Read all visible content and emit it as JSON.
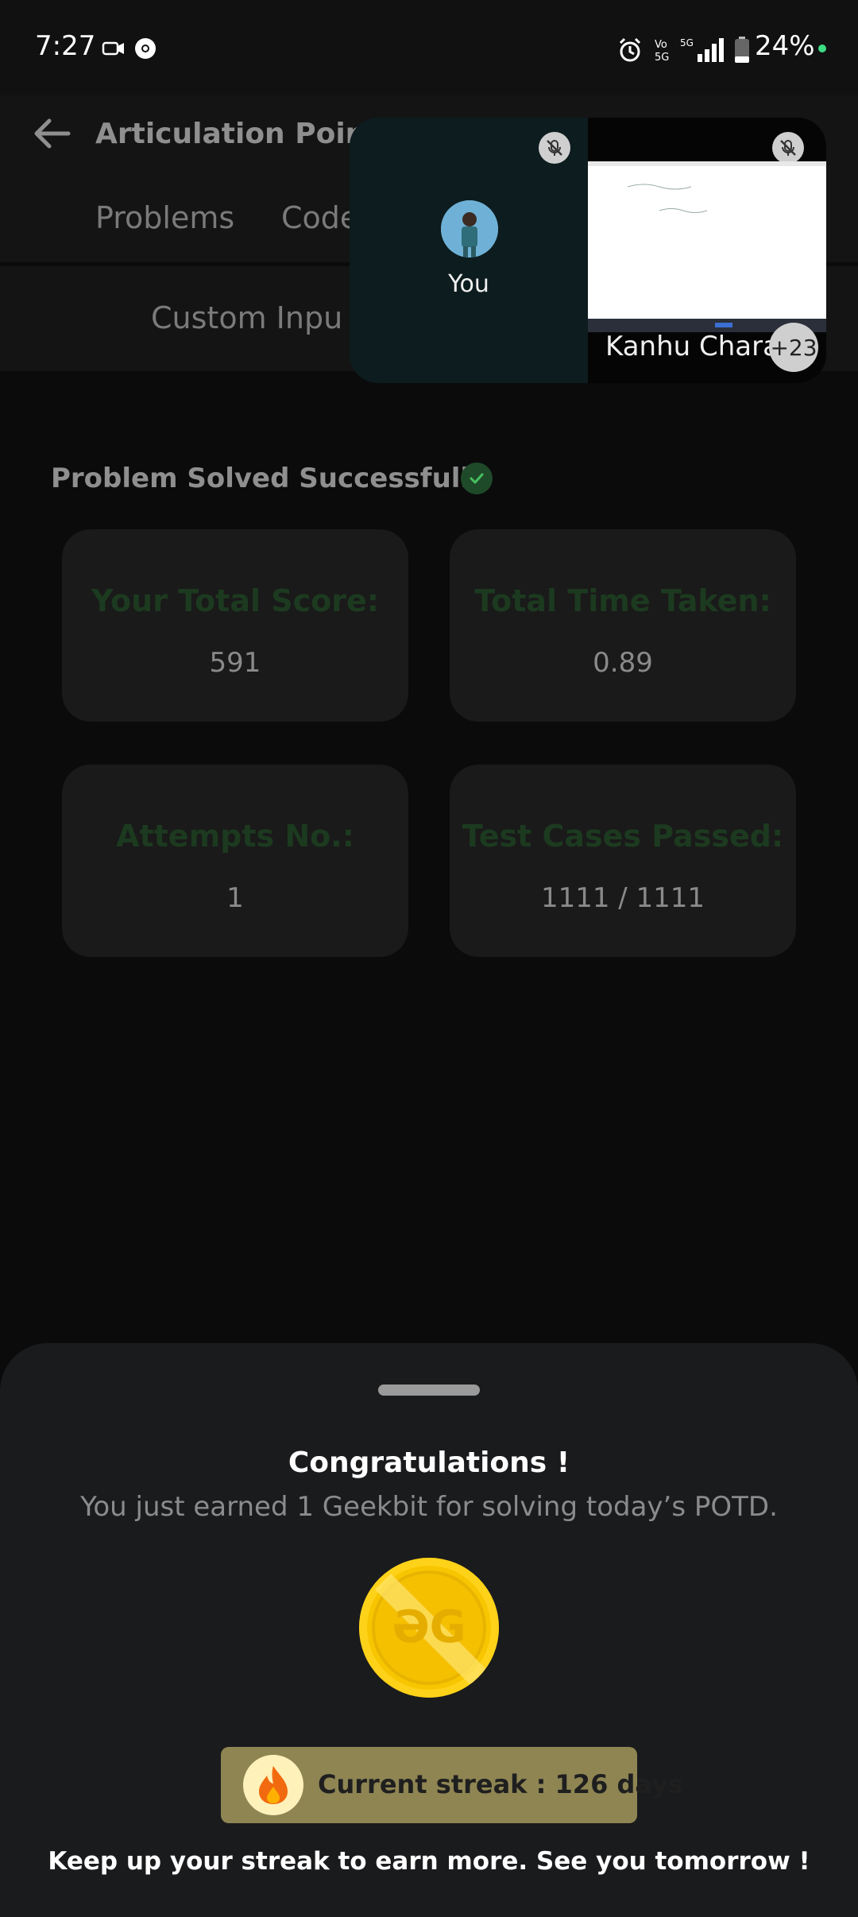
{
  "status_bar": {
    "time": "7:27",
    "battery": "24%",
    "icons": [
      "video-camera-icon",
      "chrome-icon",
      "alarm-icon",
      "volte-icon",
      "5g-icon",
      "signal-icon",
      "battery-icon"
    ]
  },
  "header": {
    "title": "Articulation Point -",
    "tabs": [
      "Problems",
      "Code"
    ],
    "custom_input": "Custom Inpu"
  },
  "call": {
    "self_label": "You",
    "remote_name": "Kanhu Chara",
    "participants_extra": "+23"
  },
  "result": {
    "solved_label": "Problem Solved Successfully",
    "stats": [
      {
        "title": "Your Total Score:",
        "value": "591"
      },
      {
        "title": "Total Time Taken:",
        "value": "0.89"
      },
      {
        "title": "Attempts No.:",
        "value": "1"
      },
      {
        "title": "Test Cases Passed:",
        "value": "1111 / 1111"
      }
    ]
  },
  "sheet": {
    "title": "Congratulations !",
    "earn_text": "You just earned 1 Geekbit for solving today’s POTD.",
    "streak": "Current streak : 126 days",
    "footer": "Keep up your streak to earn more. See you tomorrow !"
  },
  "colors": {
    "accent_green": "#1f4a29",
    "streak_bg": "#8e8553",
    "coin": "#f7c600"
  }
}
